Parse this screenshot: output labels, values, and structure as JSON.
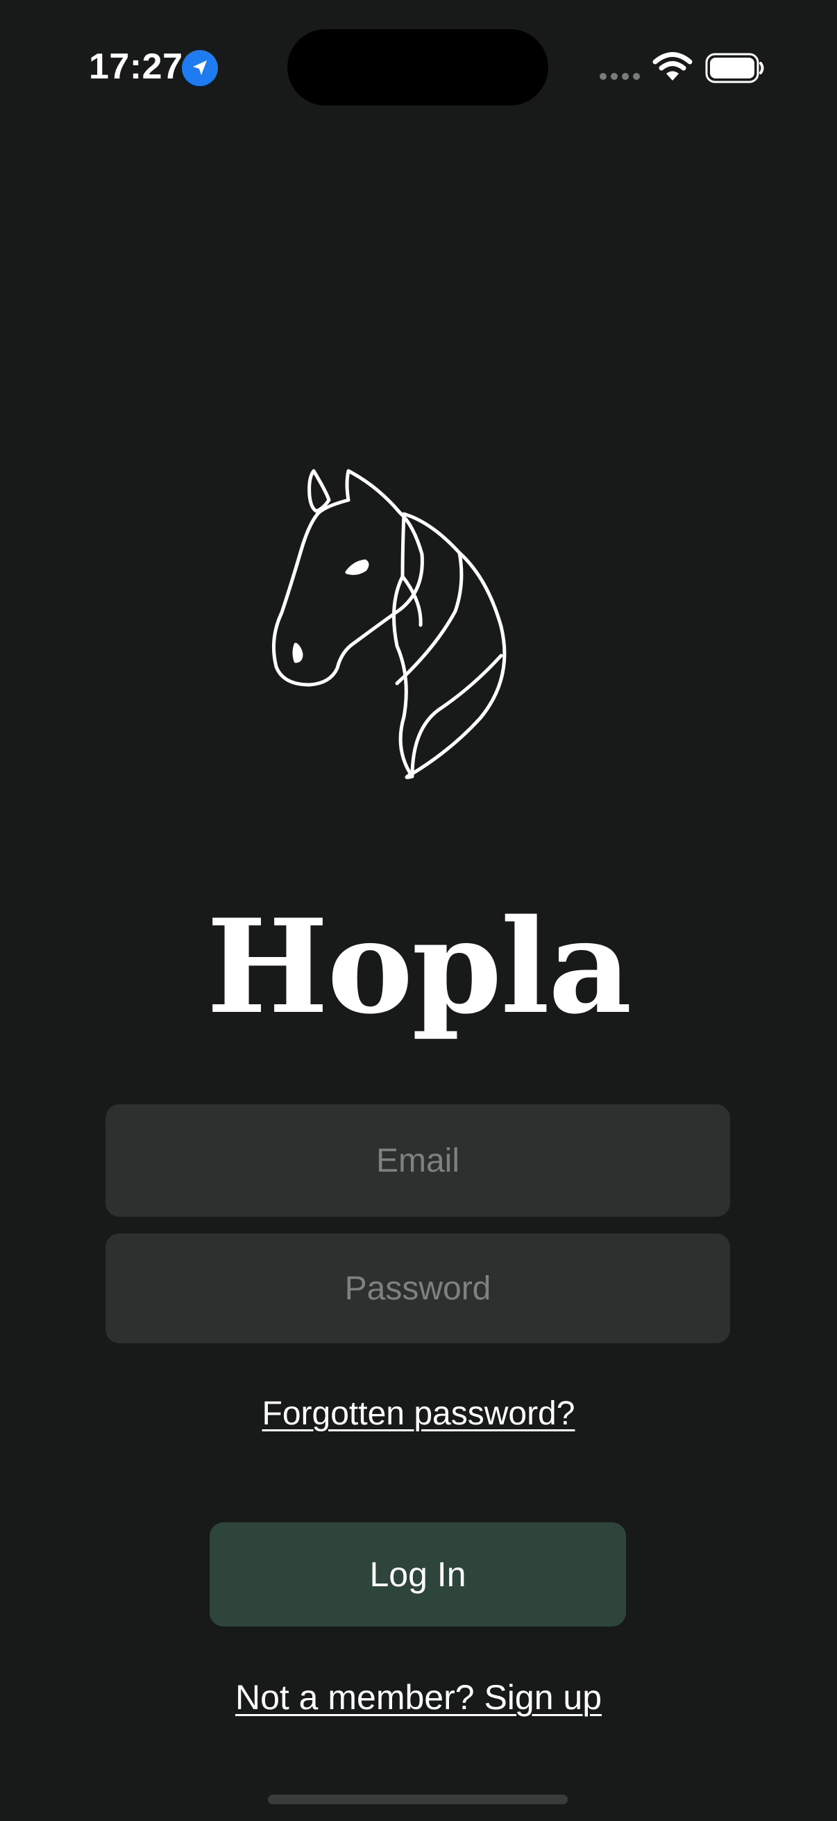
{
  "status_bar": {
    "time": "17:27",
    "icons": [
      "location-arrow-icon",
      "cellular-signal-icon",
      "wifi-icon",
      "battery-icon"
    ],
    "location_badge_color": "#1e7bf0"
  },
  "logo": {
    "icon": "horse-head-icon"
  },
  "app": {
    "title": "Hopla"
  },
  "form": {
    "email_placeholder": "Email",
    "password_placeholder": "Password",
    "forgot_password_label": "Forgotten password?",
    "login_label": "Log In",
    "signup_label": "Not a member? Sign up"
  },
  "colors": {
    "background": "#181a1a",
    "field_background": "#2e2f2f",
    "primary_button": "#2e453c",
    "text": "#ffffff",
    "placeholder": "#7f8080"
  }
}
